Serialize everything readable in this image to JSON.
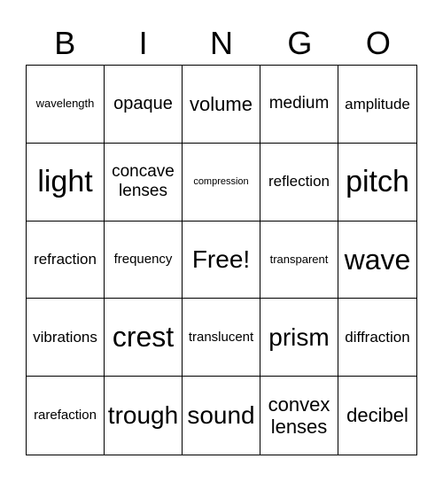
{
  "header": [
    "B",
    "I",
    "N",
    "G",
    "O"
  ],
  "cells": [
    [
      "wavelength",
      "opaque",
      "volume",
      "medium",
      "amplitude"
    ],
    [
      "light",
      "concave lenses",
      "compression",
      "reflection",
      "pitch"
    ],
    [
      "refraction",
      "frequency",
      "Free!",
      "transparent",
      "wave"
    ],
    [
      "vibrations",
      "crest",
      "translucent",
      "prism",
      "diffraction"
    ],
    [
      "rarefaction",
      "trough",
      "sound",
      "convex lenses",
      "decibel"
    ]
  ]
}
